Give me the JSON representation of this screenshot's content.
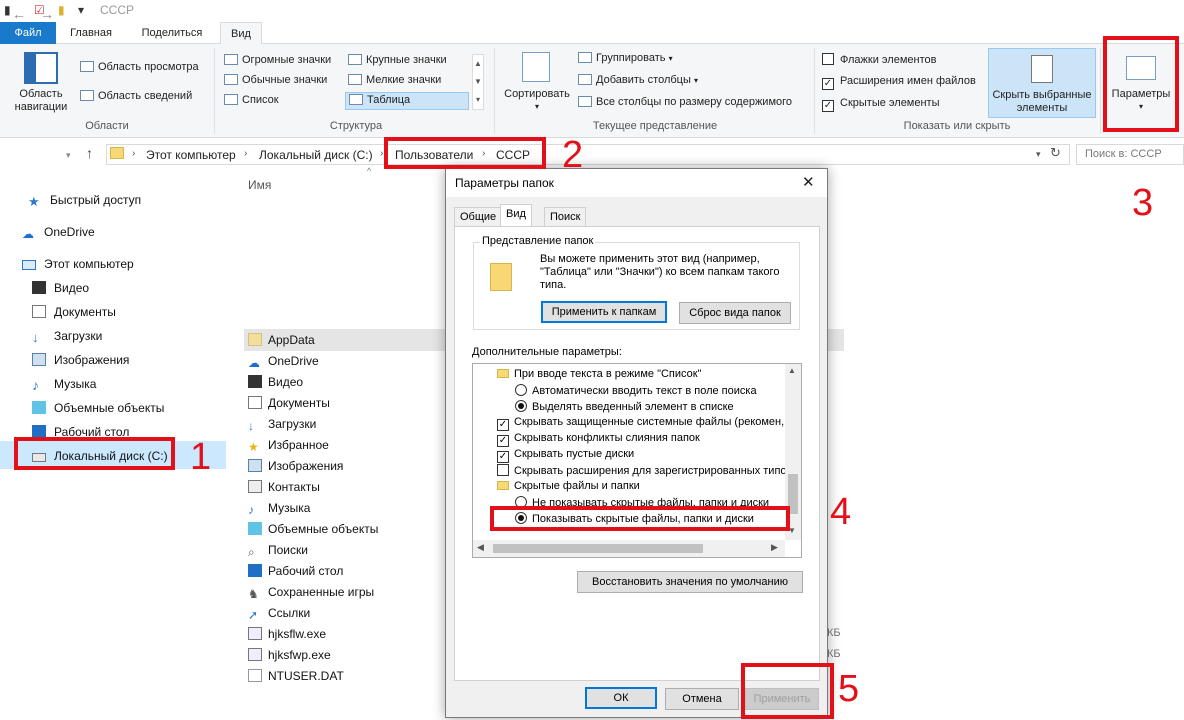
{
  "window": {
    "title": "СССР"
  },
  "ribbon_tabs": [
    "Файл",
    "Главная",
    "Поделиться",
    "Вид"
  ],
  "ribbon": {
    "nav_pane": "Область навигации",
    "preview_pane": "Область просмотра",
    "details_pane": "Область сведений",
    "group_areas": "Области",
    "layouts": [
      "Огромные значки",
      "Крупные значки",
      "Обычные значки",
      "Мелкие значки",
      "Список",
      "Таблица"
    ],
    "group_structure": "Структура",
    "sort": "Сортировать",
    "group_by": "Группировать",
    "add_columns": "Добавить столбцы",
    "fit_columns": "Все столбцы по размеру содержимого",
    "group_current_view": "Текущее представление",
    "item_checkboxes": "Флажки элементов",
    "file_extensions": "Расширения имен файлов",
    "hidden_items": "Скрытые элементы",
    "hide_selected": "Скрыть выбранные элементы",
    "group_show_hide": "Показать или скрыть",
    "options": "Параметры"
  },
  "address": {
    "crumbs": [
      "Этот компьютер",
      "Локальный диск (C:)",
      "Пользователи",
      "СССР"
    ],
    "search_placeholder": "Поиск в: СССР"
  },
  "nav_pane": {
    "items": [
      "Быстрый доступ",
      "OneDrive",
      "Этот компьютер",
      "Видео",
      "Документы",
      "Загрузки",
      "Изображения",
      "Музыка",
      "Объемные объекты",
      "Рабочий стол",
      "Локальный диск (C:)"
    ]
  },
  "file_list": {
    "column_name": "Имя",
    "items": [
      "AppData",
      "OneDrive",
      "Видео",
      "Документы",
      "Загрузки",
      "Избранное",
      "Изображения",
      "Контакты",
      "Музыка",
      "Объемные объекты",
      "Поиски",
      "Рабочий стол",
      "Сохраненные игры",
      "Ссылки",
      "hjksflw.exe",
      "hjksfwp.exe",
      "NTUSER.DAT"
    ],
    "size_fragments": [
      "КБ",
      "КБ"
    ]
  },
  "dialog": {
    "title": "Параметры папок",
    "tabs": [
      "Общие",
      "Вид",
      "Поиск"
    ],
    "folder_views_legend": "Представление папок",
    "folder_views_text": "Вы можете применить этот вид (например, \"Таблица\" или \"Значки\") ко всем папкам такого типа.",
    "apply_to_folders": "Применить к папкам",
    "reset_folders": "Сброс вида папок",
    "advanced_label": "Дополнительные параметры:",
    "tree": [
      "При вводе текста в режиме \"Список\"",
      "Автоматически вводить текст в поле поиска",
      "Выделять введенный элемент в списке",
      "Скрывать защищенные системные файлы (рекомен,",
      "Скрывать конфликты слияния папок",
      "Скрывать пустые диски",
      "Скрывать расширения для зарегистрированных типо",
      "Скрытые файлы и папки",
      "Не показывать скрытые файлы, папки и диски",
      "Показывать скрытые файлы, папки и диски"
    ],
    "restore_defaults": "Восстановить значения по умолчанию",
    "ok": "ОК",
    "cancel": "Отмена",
    "apply": "Применить"
  },
  "annotations": [
    "1",
    "2",
    "3",
    "4",
    "5"
  ],
  "colors": {
    "accent": "#1979ca",
    "annotation": "#e3101a",
    "selection": "#cce8ff"
  }
}
